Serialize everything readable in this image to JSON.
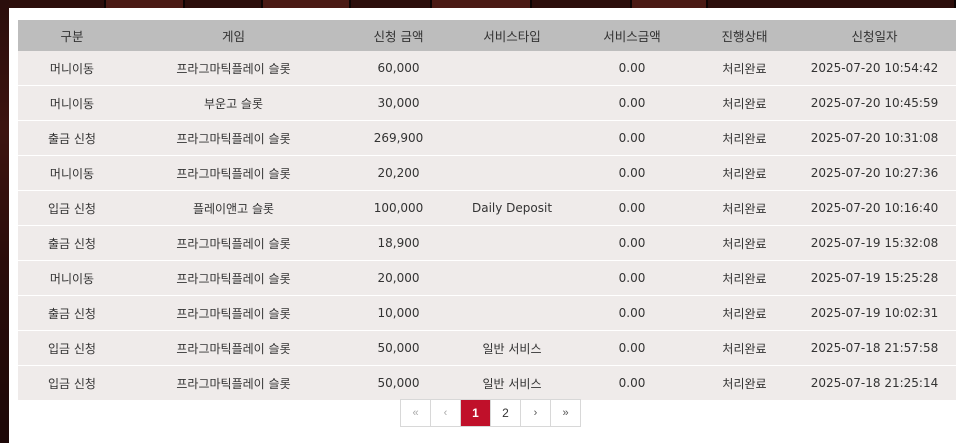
{
  "table": {
    "headers": [
      "구분",
      "게임",
      "신청 금액",
      "서비스타입",
      "서비스금액",
      "진행상태",
      "신청일자"
    ],
    "rows": [
      [
        "머니이동",
        "프라그마틱플레이 슬롯",
        "60,000",
        "",
        "0.00",
        "처리완료",
        "2025-07-20 10:54:42"
      ],
      [
        "머니이동",
        "부운고 슬롯",
        "30,000",
        "",
        "0.00",
        "처리완료",
        "2025-07-20 10:45:59"
      ],
      [
        "출금 신청",
        "프라그마틱플레이 슬롯",
        "269,900",
        "",
        "0.00",
        "처리완료",
        "2025-07-20 10:31:08"
      ],
      [
        "머니이동",
        "프라그마틱플레이 슬롯",
        "20,200",
        "",
        "0.00",
        "처리완료",
        "2025-07-20 10:27:36"
      ],
      [
        "입금 신청",
        "플레이앤고 슬롯",
        "100,000",
        "Daily Deposit",
        "0.00",
        "처리완료",
        "2025-07-20 10:16:40"
      ],
      [
        "출금 신청",
        "프라그마틱플레이 슬롯",
        "18,900",
        "",
        "0.00",
        "처리완료",
        "2025-07-19 15:32:08"
      ],
      [
        "머니이동",
        "프라그마틱플레이 슬롯",
        "20,000",
        "",
        "0.00",
        "처리완료",
        "2025-07-19 15:25:28"
      ],
      [
        "출금 신청",
        "프라그마틱플레이 슬롯",
        "10,000",
        "",
        "0.00",
        "처리완료",
        "2025-07-19 10:02:31"
      ],
      [
        "입금 신청",
        "프라그마틱플레이 슬롯",
        "50,000",
        "일반 서비스",
        "0.00",
        "처리완료",
        "2025-07-18 21:57:58"
      ],
      [
        "입금 신청",
        "프라그마틱플레이 슬롯",
        "50,000",
        "일반 서비스",
        "0.00",
        "처리완료",
        "2025-07-18 21:25:14"
      ]
    ]
  },
  "pagination": {
    "first": "«",
    "prev": "‹",
    "pages": [
      "1",
      "2"
    ],
    "active_page": "1",
    "next": "›",
    "last": "»"
  },
  "colors": {
    "header_bg": "#bdbdbd",
    "row_bg": "#efebea",
    "active_page": "#c0102a"
  }
}
